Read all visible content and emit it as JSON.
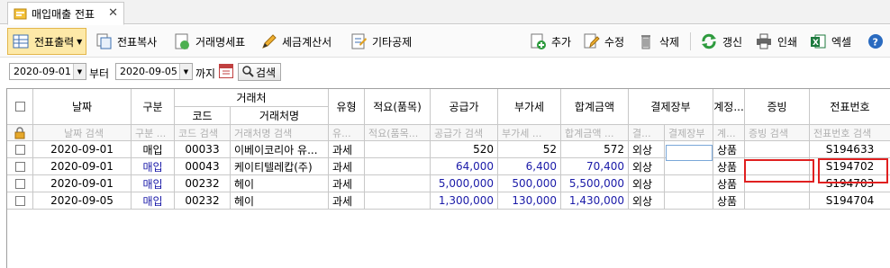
{
  "tab": {
    "label": "매입매출 전표",
    "close": "✕"
  },
  "toolbar": {
    "slip_output": "전표출력",
    "slip_copy": "전표복사",
    "statement": "거래명세표",
    "tax_invoice": "세금계산서",
    "other_deduction": "기타공제",
    "add": "추가",
    "edit": "수정",
    "delete": "삭제",
    "refresh": "갱신",
    "print": "인쇄",
    "excel": "엑셀"
  },
  "filter": {
    "from_date": "2020-09-01",
    "from_label": "부터",
    "to_date": "2020-09-05",
    "to_label": "까지",
    "search_label": "검색"
  },
  "grid": {
    "headers": {
      "date": "날짜",
      "category": "구분",
      "partner": "거래처",
      "code": "코드",
      "partner_name": "거래처명",
      "type": "유형",
      "summary": "적요(품목)",
      "supply": "공급가",
      "vat": "부가세",
      "total": "합계금액",
      "ledger": "결제장부",
      "account": "계정...",
      "proof": "증빙",
      "slip_no": "전표번호"
    },
    "filters": {
      "date": "날짜 검색",
      "category": "구분 ...",
      "code": "코드 검색",
      "partner_name": "거래처명 검색",
      "type": "유...",
      "summary": "적요(품목...",
      "supply": "공급가 검색",
      "vat": "부가세 ...",
      "total": "합계금액 ...",
      "ledger_a": "결...",
      "ledger_b": "결제장부",
      "account": "계...",
      "proof": "증빙 검색",
      "slip_no": "전표번호 검색"
    },
    "rows": [
      {
        "date": "2020-09-01",
        "category": "매입",
        "code": "00033",
        "partner_name": "이베이코리아 유...",
        "type": "과세",
        "summary": "",
        "supply": "520",
        "vat": "52",
        "total": "572",
        "ledger": "외상",
        "account": "상품",
        "proof": "",
        "slip_no": "S194633"
      },
      {
        "date": "2020-09-01",
        "category": "매입",
        "code": "00043",
        "partner_name": "케이티텔레캅(주)",
        "type": "과세",
        "summary": "",
        "supply": "64,000",
        "vat": "6,400",
        "total": "70,400",
        "ledger": "외상",
        "account": "상품",
        "proof": "",
        "slip_no": "S194702"
      },
      {
        "date": "2020-09-01",
        "category": "매입",
        "code": "00232",
        "partner_name": "헤이",
        "type": "과세",
        "summary": "",
        "supply": "5,000,000",
        "vat": "500,000",
        "total": "5,500,000",
        "ledger": "외상",
        "account": "상품",
        "proof": "",
        "slip_no": "S194703"
      },
      {
        "date": "2020-09-05",
        "category": "매입",
        "code": "00232",
        "partner_name": "헤이",
        "type": "과세",
        "summary": "",
        "supply": "1,300,000",
        "vat": "130,000",
        "total": "1,430,000",
        "ledger": "외상",
        "account": "상품",
        "proof": "",
        "slip_no": "S194704"
      }
    ]
  },
  "colors": {
    "highlight": "#e02020",
    "amount_blue": "#1a1aa8",
    "active_button": "#fde9a8"
  }
}
